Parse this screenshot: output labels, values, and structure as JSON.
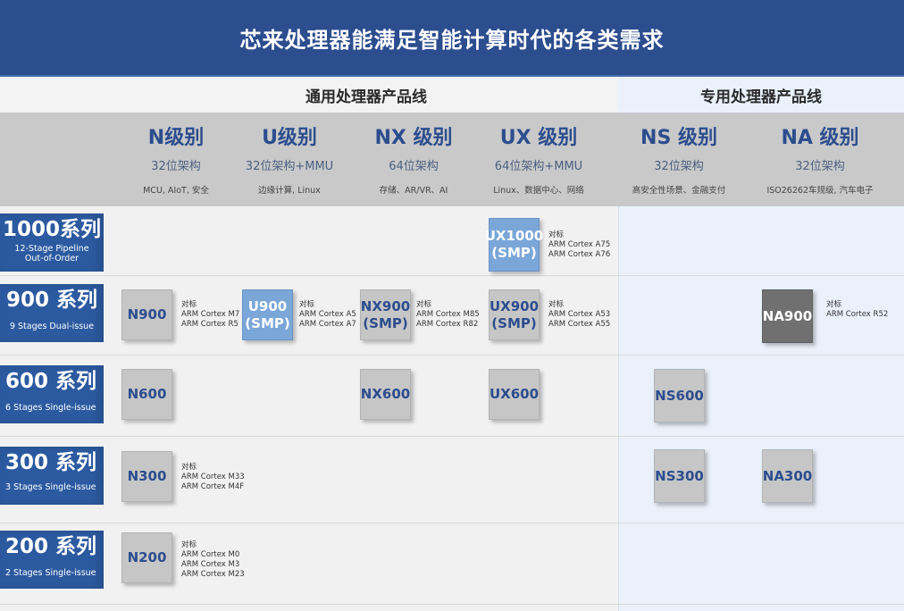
{
  "banner": {
    "title": "芯来处理器能满足智能计算时代的各类需求"
  },
  "categories": {
    "general": "通用处理器产品线",
    "special": "专用处理器产品线"
  },
  "levels": [
    {
      "name": "N级别",
      "arch": "32位架构",
      "use": "MCU, AIoT, 安全"
    },
    {
      "name": "U级别",
      "arch": "32位架构+MMU",
      "use": "边缘计算, Linux"
    },
    {
      "name": "NX 级别",
      "arch": "64位架构",
      "use": "存储、AR/VR、AI"
    },
    {
      "name": "UX 级别",
      "arch": "64位架构+MMU",
      "use": "Linux、数据中心、网络"
    },
    {
      "name": "NS 级别",
      "arch": "32位架构",
      "use": "高安全性场景、金融支付"
    },
    {
      "name": "NA 级别",
      "arch": "32位架构",
      "use": "ISO26262车规级, 汽车电子"
    }
  ],
  "series": [
    {
      "name": "1000系列",
      "desc": "12-Stage Pipeline\nOut-of-Order"
    },
    {
      "name": "900 系列",
      "desc": "9 Stages Dual-issue"
    },
    {
      "name": "600 系列",
      "desc": "6 Stages Single-issue"
    },
    {
      "name": "300 系列",
      "desc": "3 Stages Single-issue"
    },
    {
      "name": "200 系列",
      "desc": "2 Stages Single-issue"
    }
  ],
  "chips": {
    "ux1000": "UX1000\n(SMP)",
    "n900": "N900",
    "u900": "U900\n(SMP)",
    "nx900": "NX900\n(SMP)",
    "ux900": "UX900\n(SMP)",
    "na900": "NA900",
    "n600": "N600",
    "nx600": "NX600",
    "ux600": "UX600",
    "ns600": "NS600",
    "n300": "N300",
    "ns300": "NS300",
    "na300": "NA300",
    "n200": "N200"
  },
  "notes": {
    "ux1000": "对标\nARM Cortex A75\nARM Cortex A76",
    "n900": "对标\nARM Cortex M7\nARM Cortex R5",
    "u900": "对标\nARM Cortex A5\nARM Cortex A7",
    "nx900": "对标\nARM Cortex M85\nARM Cortex R82",
    "ux900": "对标\nARM Cortex A53\nARM Cortex A55",
    "na900": "对标\nARM Cortex R52",
    "n300": "对标\nARM Cortex M33\nARM Cortex M4F",
    "n200": "对标\nARM Cortex M0\nARM Cortex M3\nARM Cortex M23"
  },
  "colors": {
    "banner": "#2c4d8e",
    "series": "#2c5aa0",
    "chip": "#c6c6c6",
    "chip_blue": "#7aa6d8",
    "chip_dark": "#707070",
    "level_text": "#2c4d8e"
  }
}
